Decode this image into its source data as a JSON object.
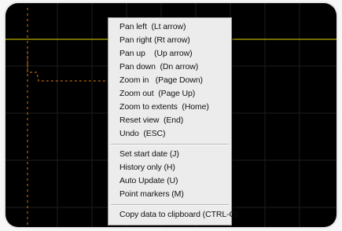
{
  "colors": {
    "plot_background": "#000000",
    "grid_line": "#1e1e1e",
    "series_yellow": "#e8d800",
    "series_orange": "#e07a10",
    "menu_background": "#ececec",
    "menu_text": "#111111"
  },
  "context_menu": {
    "groups": [
      [
        "Pan left  (Lt arrow)",
        "Pan right (Rt arrow)",
        "Pan up    (Up arrow)",
        "Pan down  (Dn arrow)",
        "Zoom in   (Page Down)",
        "Zoom out  (Page Up)",
        "Zoom to extents  (Home)",
        "Reset view  (End)",
        "Undo  (ESC)"
      ],
      [
        "Set start date (J)",
        "History only (H)",
        "Auto Update (U)",
        "Point markers (M)"
      ],
      [
        "Copy data to clipboard (CTRL-C)"
      ]
    ]
  }
}
